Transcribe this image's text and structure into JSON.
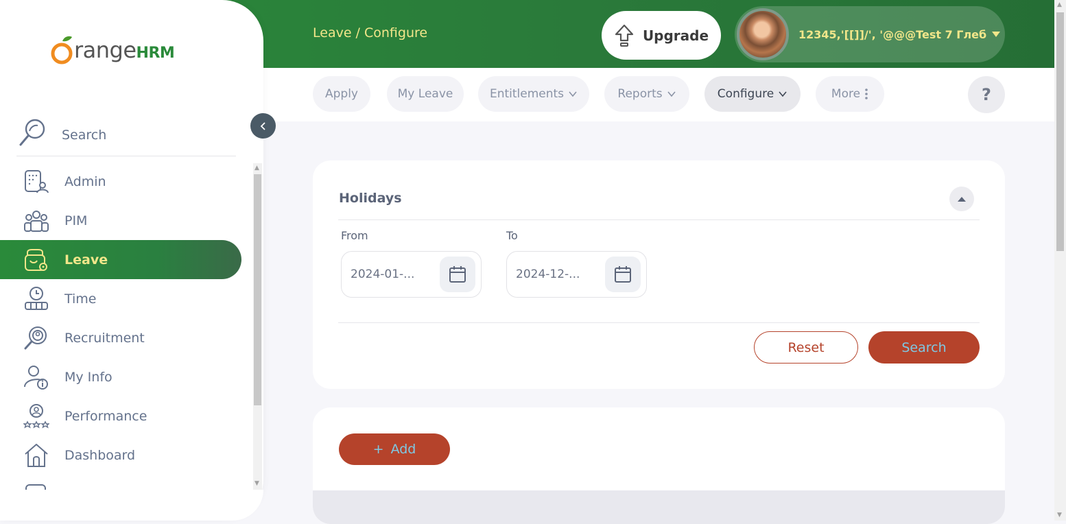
{
  "header": {
    "breadcrumb": "Leave / Configure",
    "upgrade_label": "Upgrade",
    "user_name": "12345,'[[]]/', '@@@Test 7 Глеб"
  },
  "subnav": {
    "tabs": [
      {
        "label": "Apply",
        "icon": ""
      },
      {
        "label": "My Leave",
        "icon": ""
      },
      {
        "label": "Entitlements",
        "icon": "chevron-down-icon"
      },
      {
        "label": "Reports",
        "icon": "chevron-down-icon"
      },
      {
        "label": "Configure",
        "icon": "chevron-down-icon",
        "active": true
      },
      {
        "label": "More",
        "icon": "kebab-icon"
      }
    ],
    "help_label": "?"
  },
  "sidebar": {
    "logo_main": "range",
    "logo_hrm": "HRM",
    "search_label": "Search",
    "items": [
      {
        "label": "Admin",
        "icon": "admin-icon"
      },
      {
        "label": "PIM",
        "icon": "pim-icon"
      },
      {
        "label": "Leave",
        "icon": "leave-icon",
        "active": true
      },
      {
        "label": "Time",
        "icon": "time-icon"
      },
      {
        "label": "Recruitment",
        "icon": "recruitment-icon"
      },
      {
        "label": "My Info",
        "icon": "my-info-icon"
      },
      {
        "label": "Performance",
        "icon": "performance-icon"
      },
      {
        "label": "Dashboard",
        "icon": "dashboard-icon"
      }
    ]
  },
  "holidays_filter": {
    "title": "Holidays",
    "from_label": "From",
    "from_value": "2024-01-...",
    "to_label": "To",
    "to_value": "2024-12-...",
    "reset_label": "Reset",
    "search_label": "Search"
  },
  "list": {
    "add_label": "Add",
    "add_icon": "+"
  },
  "colors": {
    "brand_green": "#2a8a3a",
    "accent_orange": "#b5432b",
    "header_text": "#f2e68a"
  }
}
